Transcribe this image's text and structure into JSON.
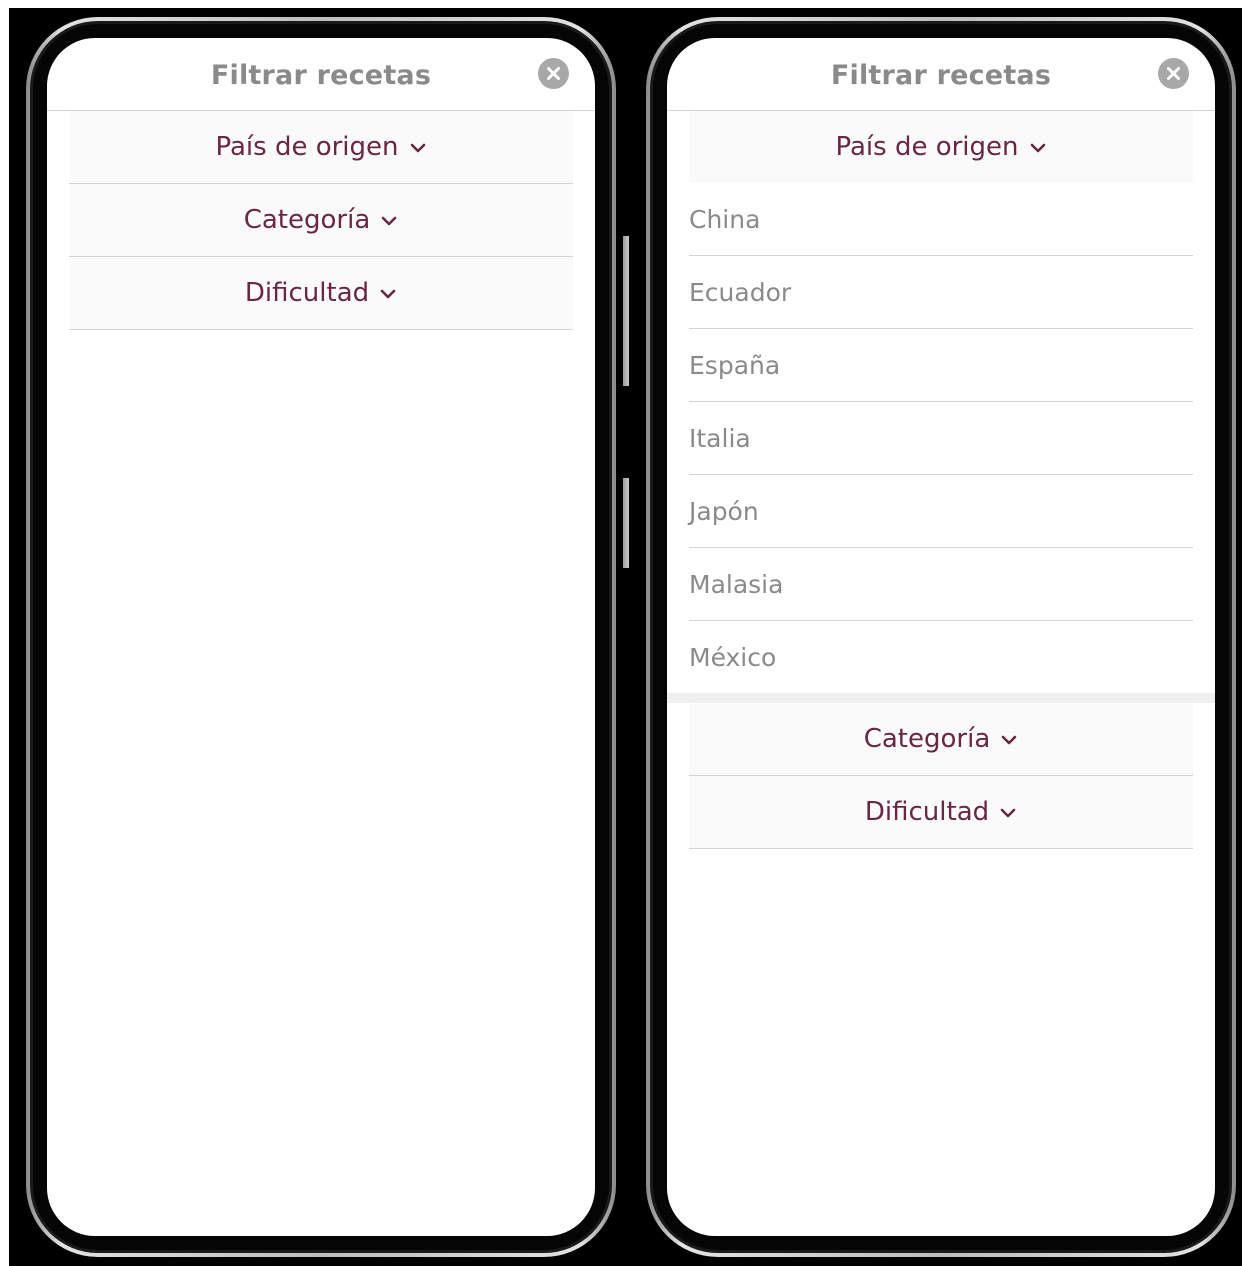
{
  "left_screen": {
    "title": "Filtrar recetas",
    "sections": [
      {
        "label": "País de origen"
      },
      {
        "label": "Categoría"
      },
      {
        "label": "Dificultad"
      }
    ]
  },
  "right_screen": {
    "title": "Filtrar recetas",
    "expanded_section": "País de origen",
    "countries": [
      "China",
      "Ecuador",
      "España",
      "Italia",
      "Japón",
      "Malasia",
      "México"
    ],
    "other_sections": [
      {
        "label": "Categoría"
      },
      {
        "label": "Dificultad"
      }
    ]
  },
  "icons": {
    "close": "close-circle-icon",
    "chevron": "chevron-down-icon"
  },
  "colors": {
    "accent": "#6a2645",
    "title_gray": "#8a8a8a",
    "divider": "#d4d4d4"
  }
}
